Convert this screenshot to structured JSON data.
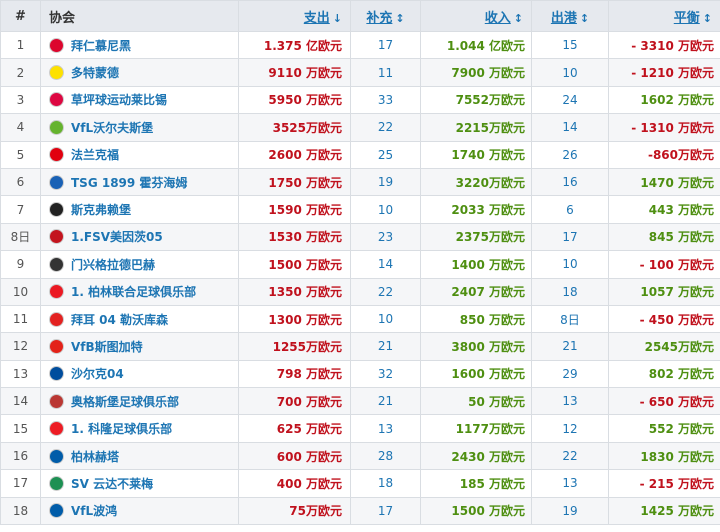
{
  "header": {
    "num": "#",
    "club": "协会",
    "expenditure": "支出",
    "expenditure_sort": "↓",
    "arrivals": "补充",
    "arrivals_sort": "↕",
    "income": "收入",
    "income_sort": "↕",
    "departures": "出港",
    "departures_sort": "↕",
    "balance": "平衡",
    "balance_sort": "↕"
  },
  "rows": [
    {
      "num": "1",
      "crest_icon": "bayern-crest-icon",
      "crest_color": "#dc052d",
      "club": "拜仁慕尼黑",
      "expenditure": "1.375 亿欧元",
      "arrivals": "17",
      "income": "1.044 亿欧元",
      "departures": "15",
      "balance": "- 3310 万欧元",
      "balance_sign": "neg"
    },
    {
      "num": "2",
      "crest_icon": "dortmund-crest-icon",
      "crest_color": "#fde100",
      "club": "多特蒙德",
      "expenditure": "9110 万欧元",
      "arrivals": "11",
      "income": "7900 万欧元",
      "departures": "10",
      "balance": "- 1210 万欧元",
      "balance_sign": "neg"
    },
    {
      "num": "3",
      "crest_icon": "leipzig-crest-icon",
      "crest_color": "#dd0741",
      "club": "草坪球运动莱比锡",
      "expenditure": "5950 万欧元",
      "arrivals": "33",
      "income": "7552万欧元",
      "departures": "24",
      "balance": "1602 万欧元",
      "balance_sign": "pos"
    },
    {
      "num": "4",
      "crest_icon": "wolfsburg-crest-icon",
      "crest_color": "#65b32e",
      "club": "VfL沃尔夫斯堡",
      "expenditure": "3525万欧元",
      "arrivals": "22",
      "income": "2215万欧元",
      "departures": "14",
      "balance": "- 1310 万欧元",
      "balance_sign": "neg"
    },
    {
      "num": "5",
      "crest_icon": "frankfurt-crest-icon",
      "crest_color": "#e1000f",
      "club": "法兰克福",
      "expenditure": "2600 万欧元",
      "arrivals": "25",
      "income": "1740 万欧元",
      "departures": "26",
      "balance": "-860万欧元",
      "balance_sign": "neg"
    },
    {
      "num": "6",
      "crest_icon": "hoffenheim-crest-icon",
      "crest_color": "#1961b5",
      "club": "TSG 1899 霍芬海姆",
      "expenditure": "1750 万欧元",
      "arrivals": "19",
      "income": "3220万欧元",
      "departures": "16",
      "balance": "1470 万欧元",
      "balance_sign": "pos"
    },
    {
      "num": "7",
      "crest_icon": "freiburg-crest-icon",
      "crest_color": "#222222",
      "club": "斯克弗赖堡",
      "expenditure": "1590 万欧元",
      "arrivals": "10",
      "income": "2033 万欧元",
      "departures": "6",
      "balance": "443 万欧元",
      "balance_sign": "pos"
    },
    {
      "num": "8日",
      "crest_icon": "mainz-crest-icon",
      "crest_color": "#c3141e",
      "club": "1.FSV美因茨05",
      "expenditure": "1530 万欧元",
      "arrivals": "23",
      "income": "2375万欧元",
      "departures": "17",
      "balance": "845 万欧元",
      "balance_sign": "pos"
    },
    {
      "num": "9",
      "crest_icon": "gladbach-crest-icon",
      "crest_color": "#333333",
      "club": "门兴格拉德巴赫",
      "expenditure": "1500 万欧元",
      "arrivals": "14",
      "income": "1400 万欧元",
      "departures": "10",
      "balance": "- 100 万欧元",
      "balance_sign": "neg"
    },
    {
      "num": "10",
      "crest_icon": "union-berlin-crest-icon",
      "crest_color": "#eb1923",
      "club": "1. 柏林联合足球俱乐部",
      "expenditure": "1350 万欧元",
      "arrivals": "22",
      "income": "2407 万欧元",
      "departures": "18",
      "balance": "1057 万欧元",
      "balance_sign": "pos"
    },
    {
      "num": "11",
      "crest_icon": "leverkusen-crest-icon",
      "crest_color": "#e32221",
      "club": "拜耳 04 勒沃库森",
      "expenditure": "1300 万欧元",
      "arrivals": "10",
      "income": "850 万欧元",
      "departures": "8日",
      "balance": "- 450 万欧元",
      "balance_sign": "neg"
    },
    {
      "num": "12",
      "crest_icon": "stuttgart-crest-icon",
      "crest_color": "#e32219",
      "club": "VfB斯图加特",
      "expenditure": "1255万欧元",
      "arrivals": "21",
      "income": "3800 万欧元",
      "departures": "21",
      "balance": "2545万欧元",
      "balance_sign": "pos"
    },
    {
      "num": "13",
      "crest_icon": "schalke-crest-icon",
      "crest_color": "#004d9d",
      "club": "沙尔克04",
      "expenditure": "798 万欧元",
      "arrivals": "32",
      "income": "1600 万欧元",
      "departures": "29",
      "balance": "802 万欧元",
      "balance_sign": "pos"
    },
    {
      "num": "14",
      "crest_icon": "augsburg-crest-icon",
      "crest_color": "#ba3733",
      "club": "奥格斯堡足球俱乐部",
      "expenditure": "700 万欧元",
      "arrivals": "21",
      "income": "50 万欧元",
      "departures": "13",
      "balance": "- 650 万欧元",
      "balance_sign": "neg"
    },
    {
      "num": "15",
      "crest_icon": "koeln-crest-icon",
      "crest_color": "#ed1c24",
      "club": "1. 科隆足球俱乐部",
      "expenditure": "625 万欧元",
      "arrivals": "13",
      "income": "1177万欧元",
      "departures": "12",
      "balance": "552 万欧元",
      "balance_sign": "pos"
    },
    {
      "num": "16",
      "crest_icon": "hertha-crest-icon",
      "crest_color": "#005ca9",
      "club": "柏林赫塔",
      "expenditure": "600 万欧元",
      "arrivals": "28",
      "income": "2430 万欧元",
      "departures": "22",
      "balance": "1830 万欧元",
      "balance_sign": "pos"
    },
    {
      "num": "17",
      "crest_icon": "werder-crest-icon",
      "crest_color": "#1d9053",
      "club": "SV 云达不莱梅",
      "expenditure": "400 万欧元",
      "arrivals": "18",
      "income": "185 万欧元",
      "departures": "13",
      "balance": "- 215 万欧元",
      "balance_sign": "neg"
    },
    {
      "num": "18",
      "crest_icon": "bochum-crest-icon",
      "crest_color": "#005ca9",
      "club": "VfL波鸿",
      "expenditure": "75万欧元",
      "arrivals": "17",
      "income": "1500 万欧元",
      "departures": "19",
      "balance": "1425 万欧元",
      "balance_sign": "pos"
    }
  ]
}
